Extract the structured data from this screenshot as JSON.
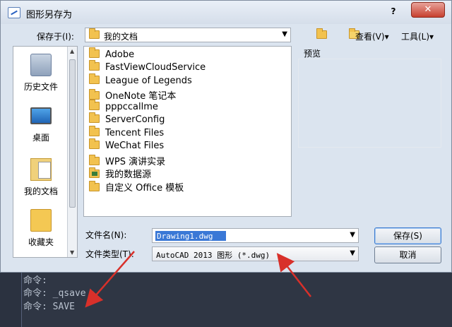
{
  "window": {
    "title": "图形另存为",
    "help": "?",
    "close": "✕"
  },
  "save_in": {
    "label": "保存于(I):",
    "value": "我的文档"
  },
  "toolbar": {
    "view_label": "查看(V)▾",
    "tools_label": "工具(L)▾"
  },
  "places": [
    {
      "label": "历史文件",
      "icon": "history-icon"
    },
    {
      "label": "桌面",
      "icon": "desktop-icon"
    },
    {
      "label": "我的文档",
      "icon": "my-documents-icon"
    },
    {
      "label": "收藏夹",
      "icon": "favorites-icon"
    }
  ],
  "files": [
    "Adobe",
    "FastViewCloudService",
    "League of Legends",
    "OneNote 笔记本",
    "pppccallme",
    "ServerConfig",
    "Tencent Files",
    "WeChat Files",
    "WPS 演讲实录",
    "我的数据源",
    "自定义 Office 模板"
  ],
  "preview": {
    "label": "预览"
  },
  "filename": {
    "label": "文件名(N):",
    "value": "Drawing1.dwg"
  },
  "filetype": {
    "label": "文件类型(T):",
    "value": "AutoCAD 2013 图形 (*.dwg)"
  },
  "buttons": {
    "save": "保存(S)",
    "cancel": "取消"
  },
  "command_lines": [
    "命令:",
    "命令: _qsave",
    "命令: SAVE"
  ],
  "colors": {
    "arrow": "#d8302a",
    "selection": "#3a78d6",
    "command_bg": "#2f3644"
  }
}
